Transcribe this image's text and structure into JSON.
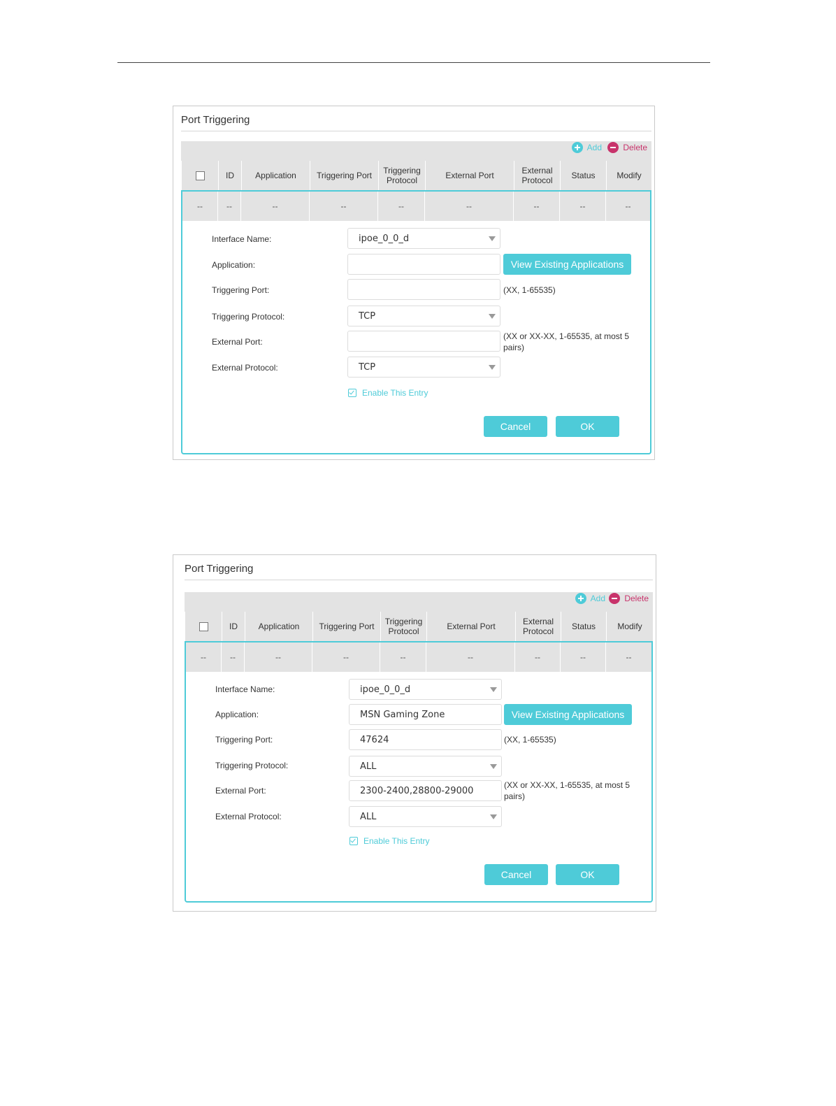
{
  "panels": [
    {
      "title": "Port Triggering",
      "toolbar": {
        "add_label": "Add",
        "delete_label": "Delete"
      },
      "columns": [
        "",
        "ID",
        "Application",
        "Triggering Port",
        "Triggering Protocol",
        "External Port",
        "External Protocol",
        "Status",
        "Modify"
      ],
      "row": [
        "--",
        "--",
        "--",
        "--",
        "--",
        "--",
        "--",
        "--",
        "--"
      ],
      "form": {
        "interface_label": "Interface Name:",
        "interface_value": "ipoe_0_0_d",
        "application_label": "Application:",
        "application_value": "",
        "view_button": "View Existing Applications",
        "triggering_port_label": "Triggering Port:",
        "triggering_port_value": "",
        "triggering_port_hint": "(XX, 1-65535)",
        "triggering_protocol_label": "Triggering Protocol:",
        "triggering_protocol_value": "TCP",
        "external_port_label": "External Port:",
        "external_port_value": "",
        "external_port_hint": "(XX or XX-XX, 1-65535, at most 5 pairs)",
        "external_protocol_label": "External Protocol:",
        "external_protocol_value": "TCP",
        "enable_label": "Enable This Entry",
        "cancel_label": "Cancel",
        "ok_label": "OK"
      }
    },
    {
      "title": "Port Triggering",
      "toolbar": {
        "add_label": "Add",
        "delete_label": "Delete"
      },
      "columns": [
        "",
        "ID",
        "Application",
        "Triggering Port",
        "Triggering Protocol",
        "External Port",
        "External Protocol",
        "Status",
        "Modify"
      ],
      "row": [
        "--",
        "--",
        "--",
        "--",
        "--",
        "--",
        "--",
        "--",
        "--"
      ],
      "form": {
        "interface_label": "Interface Name:",
        "interface_value": "ipoe_0_0_d",
        "application_label": "Application:",
        "application_value": "MSN Gaming Zone",
        "view_button": "View Existing Applications",
        "triggering_port_label": "Triggering Port:",
        "triggering_port_value": "47624",
        "triggering_port_hint": "(XX, 1-65535)",
        "triggering_protocol_label": "Triggering Protocol:",
        "triggering_protocol_value": "ALL",
        "external_port_label": "External Port:",
        "external_port_value": "2300-2400,28800-29000",
        "external_port_hint": "(XX or XX-XX, 1-65535, at most 5 pairs)",
        "external_protocol_label": "External Protocol:",
        "external_protocol_value": "ALL",
        "enable_label": "Enable This Entry",
        "cancel_label": "Cancel",
        "ok_label": "OK"
      }
    }
  ]
}
